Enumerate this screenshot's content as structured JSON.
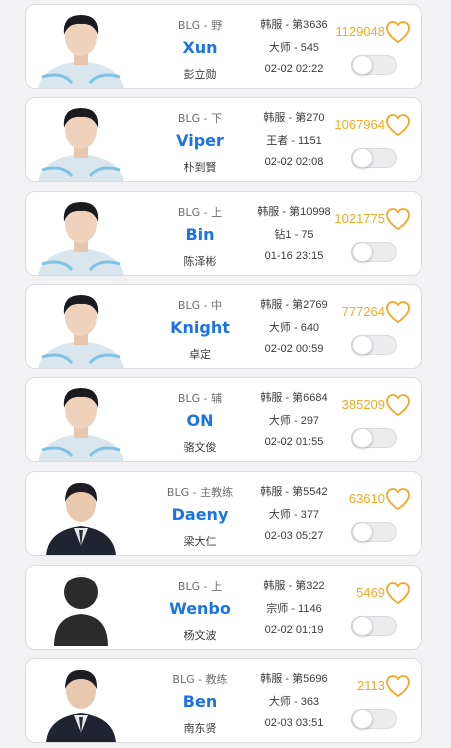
{
  "colors": {
    "nickname": "#1a73e8",
    "likes": "#f5a623",
    "heart": "#f5a623"
  },
  "players": [
    {
      "team_role": "BLG - 野",
      "nickname": "Xun",
      "real_name": "彭立勋",
      "server_rank": "韩服 - 第3636",
      "tier": "大师 - 545",
      "time": "02-02 02:22",
      "likes": "1129048",
      "avatar": "player-photo",
      "toggle_on": false
    },
    {
      "team_role": "BLG - 下",
      "nickname": "Viper",
      "real_name": "朴到賢",
      "server_rank": "韩服 - 第270",
      "tier": "王者 - 1151",
      "time": "02-02 02:08",
      "likes": "1067964",
      "avatar": "player-photo",
      "toggle_on": false
    },
    {
      "team_role": "BLG - 上",
      "nickname": "Bin",
      "real_name": "陈泽彬",
      "server_rank": "韩服 - 第10998",
      "tier": "钻1 - 75",
      "time": "01-16 23:15",
      "likes": "1021775",
      "avatar": "player-photo",
      "toggle_on": false
    },
    {
      "team_role": "BLG - 中",
      "nickname": "Knight",
      "real_name": "卓定",
      "server_rank": "韩服 - 第2769",
      "tier": "大师 - 640",
      "time": "02-02 00:59",
      "likes": "777264",
      "avatar": "player-photo",
      "toggle_on": false
    },
    {
      "team_role": "BLG - 辅",
      "nickname": "ON",
      "real_name": "骆文俊",
      "server_rank": "韩服 - 第6684",
      "tier": "大师 - 297",
      "time": "02-02 01:55",
      "likes": "385209",
      "avatar": "player-photo",
      "toggle_on": false
    },
    {
      "team_role": "BLG - 主教练",
      "nickname": "Daeny",
      "real_name": "梁大仁",
      "server_rank": "韩服 - 第5542",
      "tier": "大师 - 377",
      "time": "02-03 05:27",
      "likes": "63610",
      "avatar": "coach-photo",
      "toggle_on": false
    },
    {
      "team_role": "BLG - 上",
      "nickname": "Wenbo",
      "real_name": "杨文波",
      "server_rank": "韩服 - 第322",
      "tier": "宗师 - 1146",
      "time": "02-02 01:19",
      "likes": "5469",
      "avatar": "placeholder-silhouette",
      "toggle_on": false
    },
    {
      "team_role": "BLG - 教练",
      "nickname": "Ben",
      "real_name": "南东贤",
      "server_rank": "韩服 - 第5696",
      "tier": "大师 - 363",
      "time": "02-03 03:51",
      "likes": "2113",
      "avatar": "coach-photo",
      "toggle_on": false
    }
  ]
}
